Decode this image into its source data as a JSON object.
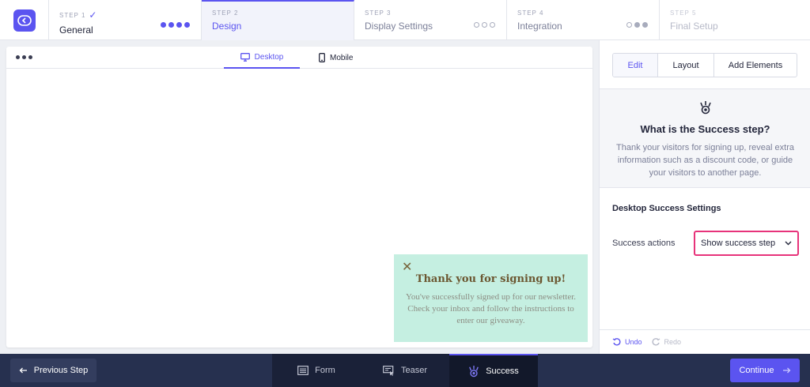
{
  "steps": [
    {
      "num": "STEP 1",
      "name": "General",
      "check": "✓"
    },
    {
      "num": "STEP 2",
      "name": "Design"
    },
    {
      "num": "STEP 3",
      "name": "Display Settings"
    },
    {
      "num": "STEP 4",
      "name": "Integration"
    },
    {
      "num": "STEP 5",
      "name": "Final Setup"
    }
  ],
  "preview": {
    "device_tabs": {
      "desktop": "Desktop",
      "mobile": "Mobile"
    },
    "success_card": {
      "close": "✕",
      "title": "Thank you for signing up!",
      "text": "You've successfully signed up for our newsletter. Check your inbox and follow the instructions to enter our giveaway."
    }
  },
  "panel": {
    "tabs": {
      "edit": "Edit",
      "layout": "Layout",
      "add": "Add Elements"
    },
    "info_title": "What is the Success step?",
    "info_text": "Thank your visitors for signing up, reveal extra information such as a discount code, or guide your visitors to another page.",
    "settings_title": "Desktop Success Settings",
    "success_actions_label": "Success actions",
    "success_actions_value": "Show success step",
    "undo": "Undo",
    "redo": "Redo"
  },
  "bottom": {
    "previous": "Previous Step",
    "tabs": {
      "form": "Form",
      "teaser": "Teaser",
      "success": "Success"
    },
    "continue": "Continue"
  },
  "colors": {
    "accent": "#5b54f0",
    "highlight": "#e7337a",
    "success_bg": "#c5efe1",
    "bottom_bar": "#26304f"
  }
}
